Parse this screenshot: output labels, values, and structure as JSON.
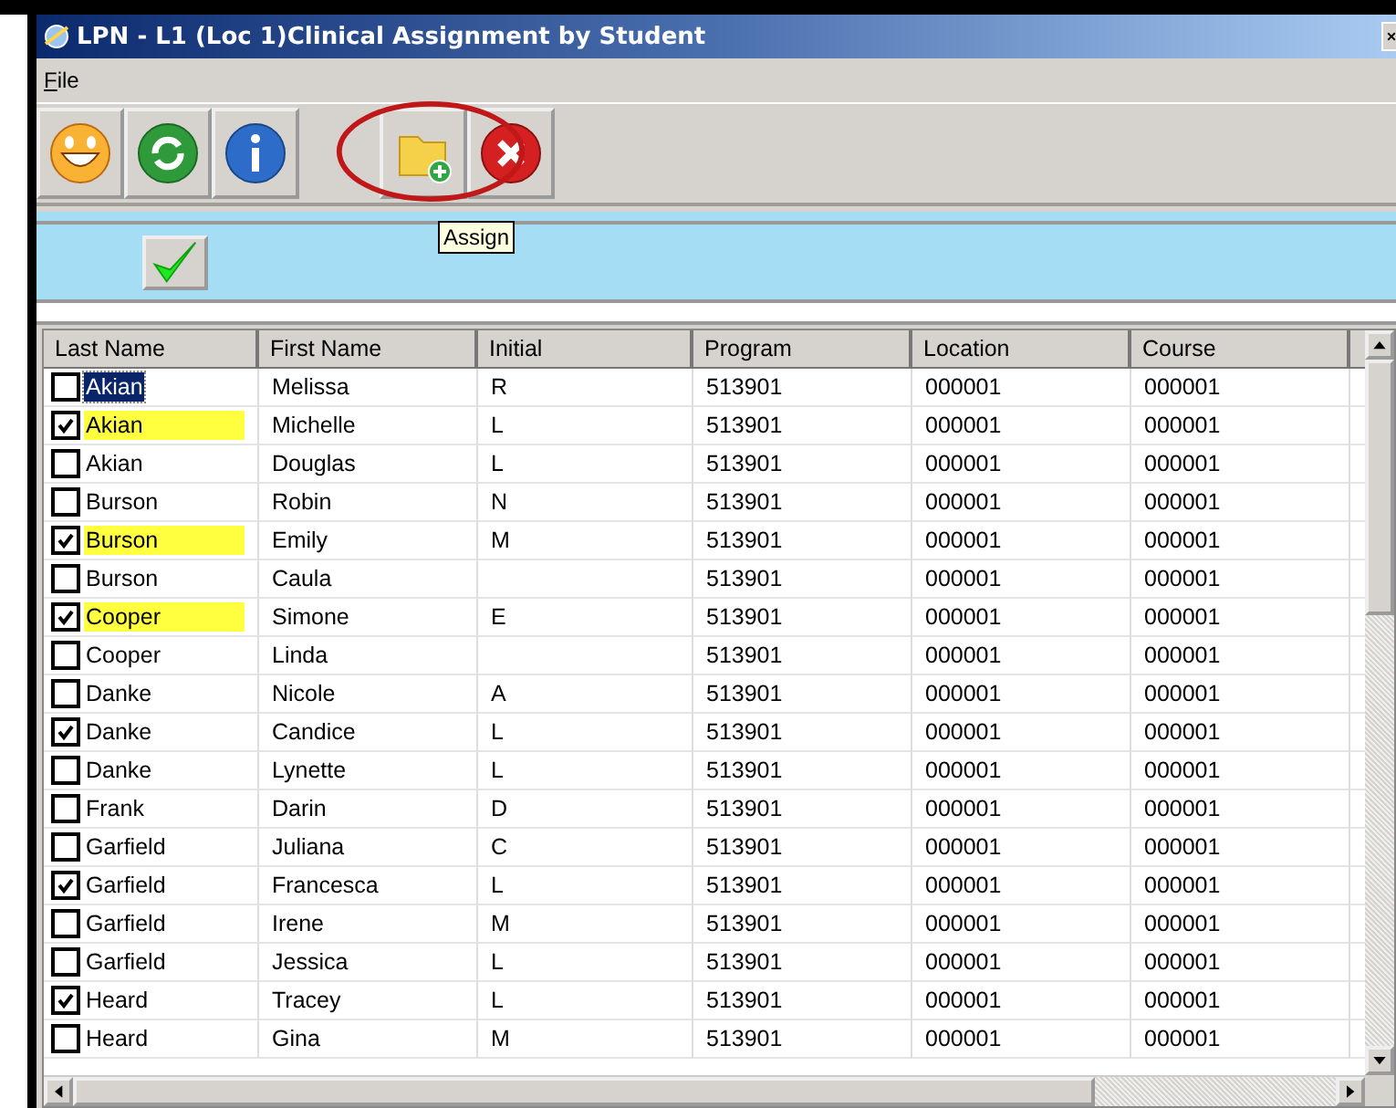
{
  "window": {
    "title": "LPN - L1 (Loc 1)Clinical Assignment by Student"
  },
  "menu": [
    "File"
  ],
  "toolbar": [
    {
      "kind": "smiley",
      "highlighted": false
    },
    {
      "kind": "refresh",
      "highlighted": false
    },
    {
      "kind": "info",
      "highlighted": false
    },
    {
      "kind": "assign",
      "highlighted": true
    },
    {
      "kind": "close",
      "highlighted": false
    }
  ],
  "tooltip": "Assign",
  "table": {
    "columns": [
      "Last Name",
      "First Name",
      "Initial",
      "Program",
      "Location",
      "Course"
    ],
    "rows": [
      {
        "checked": false,
        "highlighted": false,
        "selected": true,
        "cells": [
          "Akian",
          "Melissa",
          "R",
          "513901",
          "000001",
          "000001"
        ]
      },
      {
        "checked": true,
        "highlighted": true,
        "selected": false,
        "cells": [
          "Akian",
          "Michelle",
          "L",
          "513901",
          "000001",
          "000001"
        ]
      },
      {
        "checked": false,
        "highlighted": false,
        "selected": false,
        "cells": [
          "Akian",
          "Douglas",
          "L",
          "513901",
          "000001",
          "000001"
        ]
      },
      {
        "checked": false,
        "highlighted": false,
        "selected": false,
        "cells": [
          "Burson",
          "Robin",
          "N",
          "513901",
          "000001",
          "000001"
        ]
      },
      {
        "checked": true,
        "highlighted": true,
        "selected": false,
        "cells": [
          "Burson",
          "Emily",
          "M",
          "513901",
          "000001",
          "000001"
        ]
      },
      {
        "checked": false,
        "highlighted": false,
        "selected": false,
        "cells": [
          "Burson",
          "Caula",
          "",
          "513901",
          "000001",
          "000001"
        ]
      },
      {
        "checked": true,
        "highlighted": true,
        "selected": false,
        "cells": [
          "Cooper",
          "Simone",
          "E",
          "513901",
          "000001",
          "000001"
        ]
      },
      {
        "checked": false,
        "highlighted": false,
        "selected": false,
        "cells": [
          "Cooper",
          "Linda",
          "",
          "513901",
          "000001",
          "000001"
        ]
      },
      {
        "checked": false,
        "highlighted": false,
        "selected": false,
        "cells": [
          "Danke",
          "Nicole",
          "A",
          "513901",
          "000001",
          "000001"
        ]
      },
      {
        "checked": true,
        "highlighted": false,
        "selected": false,
        "cells": [
          "Danke",
          "Candice",
          "L",
          "513901",
          "000001",
          "000001"
        ]
      },
      {
        "checked": false,
        "highlighted": false,
        "selected": false,
        "cells": [
          "Danke",
          "Lynette",
          "L",
          "513901",
          "000001",
          "000001"
        ]
      },
      {
        "checked": false,
        "highlighted": false,
        "selected": false,
        "cells": [
          "Frank",
          "Darin",
          "D",
          "513901",
          "000001",
          "000001"
        ]
      },
      {
        "checked": false,
        "highlighted": false,
        "selected": false,
        "cells": [
          "Garfield",
          "Juliana",
          "C",
          "513901",
          "000001",
          "000001"
        ]
      },
      {
        "checked": true,
        "highlighted": false,
        "selected": false,
        "cells": [
          "Garfield",
          "Francesca",
          "L",
          "513901",
          "000001",
          "000001"
        ]
      },
      {
        "checked": false,
        "highlighted": false,
        "selected": false,
        "cells": [
          "Garfield",
          "Irene",
          "M",
          "513901",
          "000001",
          "000001"
        ]
      },
      {
        "checked": false,
        "highlighted": false,
        "selected": false,
        "cells": [
          "Garfield",
          "Jessica",
          "L",
          "513901",
          "000001",
          "000001"
        ]
      },
      {
        "checked": true,
        "highlighted": false,
        "selected": false,
        "cells": [
          "Heard",
          "Tracey",
          "L",
          "513901",
          "000001",
          "000001"
        ]
      },
      {
        "checked": false,
        "highlighted": false,
        "selected": false,
        "cells": [
          "Heard",
          "Gina",
          "M",
          "513901",
          "000001",
          "000001"
        ]
      }
    ]
  }
}
